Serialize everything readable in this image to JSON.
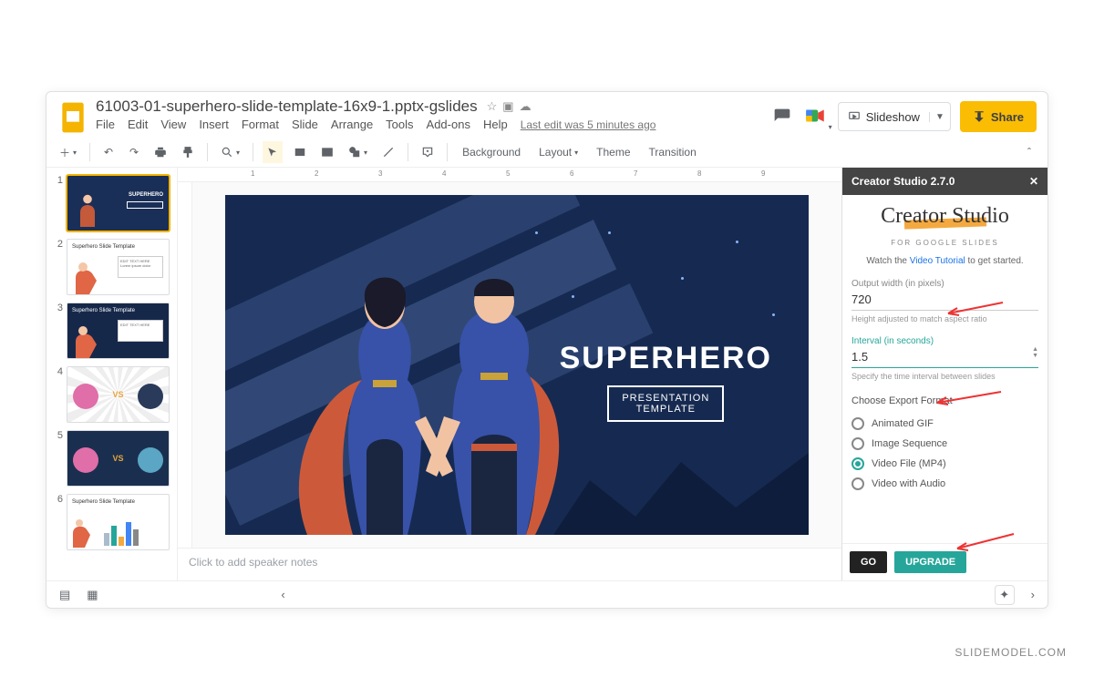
{
  "doc": {
    "title": "61003-01-superhero-slide-template-16x9-1.pptx-gslides",
    "last_edit": "Last edit was 5 minutes ago"
  },
  "menus": [
    "File",
    "Edit",
    "View",
    "Insert",
    "Format",
    "Slide",
    "Arrange",
    "Tools",
    "Add-ons",
    "Help"
  ],
  "header": {
    "slideshow": "Slideshow",
    "share": "Share"
  },
  "toolbar": {
    "background": "Background",
    "layout": "Layout",
    "theme": "Theme",
    "transition": "Transition"
  },
  "ruler_marks": [
    "1",
    "2",
    "3",
    "4",
    "5",
    "6",
    "7",
    "8",
    "9"
  ],
  "slide": {
    "title": "SUPERHERO",
    "sub1": "PRESENTATION",
    "sub2": "TEMPLATE"
  },
  "speaker_notes_placeholder": "Click to add speaker notes",
  "thumbs": {
    "t1_label": "SUPERHERO",
    "t2_title": "Superhero Slide Template",
    "t3_title": "Superhero Slide Template",
    "t4_vs": "VS",
    "t5_vs": "VS",
    "t6_title": "Superhero Slide Template"
  },
  "sidebar": {
    "header": "Creator Studio 2.7.0",
    "logo_main": "Creator Studio",
    "logo_sub": "FOR GOOGLE SLIDES",
    "watch_prefix": "Watch the ",
    "watch_link": "Video Tutorial",
    "watch_suffix": " to get started.",
    "width_label": "Output width (in pixels)",
    "width_value": "720",
    "width_helper": "Height adjusted to match aspect ratio",
    "interval_label": "Interval (in seconds)",
    "interval_value": "1.5",
    "interval_helper": "Specify the time interval between slides",
    "format_label": "Choose Export Format",
    "opt_gif": "Animated GIF",
    "opt_seq": "Image Sequence",
    "opt_mp4": "Video File (MP4)",
    "opt_audio": "Video with Audio",
    "go": "GO",
    "upgrade": "UPGRADE"
  },
  "brand": "SLIDEMODEL.COM"
}
